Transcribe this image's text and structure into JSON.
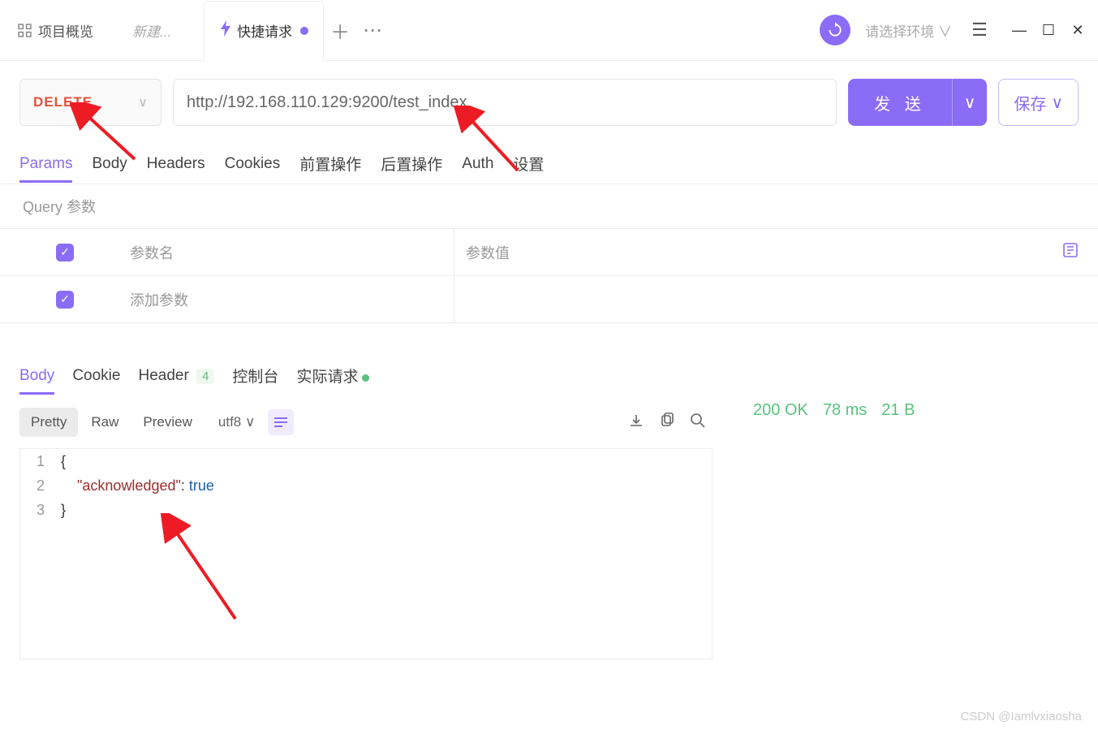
{
  "titlebar": {
    "overview": "项目概览",
    "newtab": "新建...",
    "active_tab": "快捷请求",
    "env_placeholder": "请选择环境"
  },
  "request": {
    "method": "DELETE",
    "url": "http://192.168.110.129:9200/test_index",
    "send": "发 送",
    "save": "保存"
  },
  "req_tabs": [
    "Params",
    "Body",
    "Headers",
    "Cookies",
    "前置操作",
    "后置操作",
    "Auth",
    "设置"
  ],
  "query": {
    "title": "Query 参数",
    "name_header": "参数名",
    "value_header": "参数值",
    "add_placeholder": "添加参数"
  },
  "resp_tabs": {
    "body": "Body",
    "cookie": "Cookie",
    "header": "Header",
    "header_count": "4",
    "console": "控制台",
    "actual": "实际请求"
  },
  "view_modes": [
    "Pretty",
    "Raw",
    "Preview"
  ],
  "encoding": "utf8",
  "status": {
    "code": "200 OK",
    "time": "78 ms",
    "size": "21 B"
  },
  "code": {
    "l1": "{",
    "l2_indent": "    ",
    "l2_key": "\"acknowledged\"",
    "l2_sep": ": ",
    "l2_val": "true",
    "l3": "}"
  },
  "watermark": "CSDN @Iamlvxiaosha"
}
